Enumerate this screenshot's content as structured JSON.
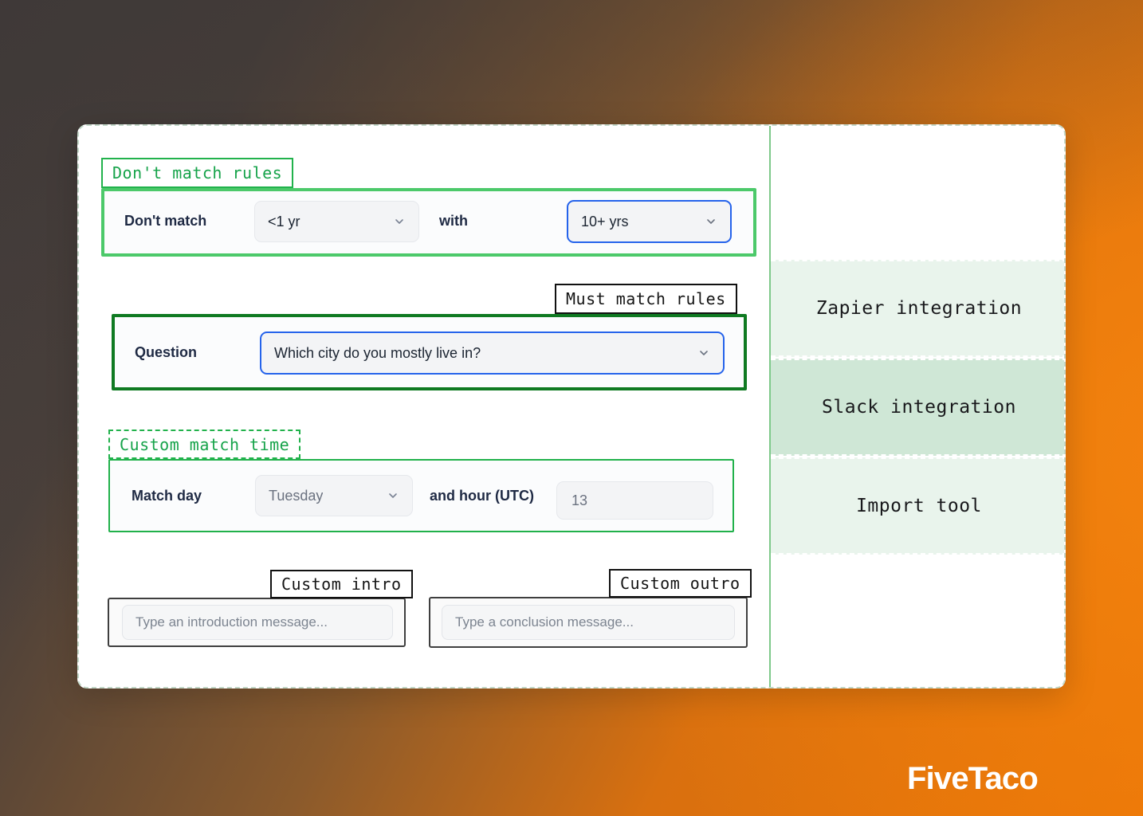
{
  "brand": {
    "name": "FiveTaco",
    "accent": "#e8700f"
  },
  "colors": {
    "green": "#22b24c",
    "dark_green": "#0f7a22",
    "blue": "#2563eb",
    "black": "#111111",
    "panel_light": "#e9f4ec",
    "panel_selected": "#cfe7d6"
  },
  "groups": {
    "dont_match": {
      "label": "Don't match rules",
      "row_label": "Don't match",
      "left_select": {
        "value": "<1 yr",
        "icon": "chevron-down-icon"
      },
      "middle_label": "with",
      "right_select": {
        "value": "10+ yrs",
        "icon": "chevron-down-icon"
      }
    },
    "must_match": {
      "label": "Must match rules",
      "row_label": "Question",
      "question_select": {
        "value": "Which city do you mostly live in?",
        "icon": "chevron-down-icon"
      }
    },
    "custom_match_time": {
      "label": "Custom match time",
      "row_label": "Match day",
      "day_select": {
        "value": "Tuesday",
        "icon": "chevron-down-icon"
      },
      "hour_label": "and hour (UTC)",
      "hour_input": {
        "value": "13"
      }
    },
    "custom_intro": {
      "label": "Custom intro",
      "input": {
        "placeholder": "Type an introduction message...",
        "value": ""
      }
    },
    "custom_outro": {
      "label": "Custom outro",
      "input": {
        "placeholder": "Type a conclusion message...",
        "value": ""
      }
    }
  },
  "side_panel": {
    "items": [
      {
        "label": "Zapier integration",
        "state": "normal"
      },
      {
        "label": "Slack integration",
        "state": "selected"
      },
      {
        "label": "Import tool",
        "state": "normal"
      }
    ]
  }
}
